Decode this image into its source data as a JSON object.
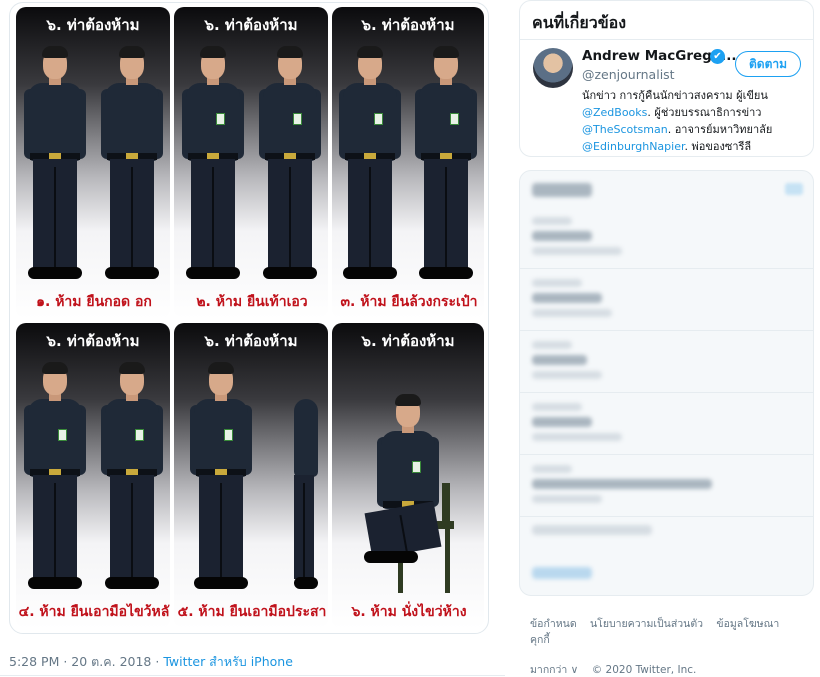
{
  "tweet": {
    "panels": [
      {
        "header": "๖. ท่าต้องห้าม",
        "caption": "๑. ห้าม ยืนกอด อก"
      },
      {
        "header": "๖. ท่าต้องห้าม",
        "caption": "๒. ห้าม ยืนเท้าเอว"
      },
      {
        "header": "๖. ท่าต้องห้าม",
        "caption": "๓. ห้าม ยืนล้วงกระเป๋า"
      },
      {
        "header": "๖. ท่าต้องห้าม",
        "caption": "๔. ห้าม ยืนเอามือไขว้หลั"
      },
      {
        "header": "๖. ท่าต้องห้าม",
        "caption": "๕. ห้าม ยืนเอามือประสา"
      },
      {
        "header": "๖. ท่าต้องห้าม",
        "caption": "๖. ห้าม นั่งไขว่ห้าง"
      }
    ],
    "time": "5:28 PM",
    "separator": " · ",
    "date": "20 ต.ค. 2018",
    "separator2": " · ",
    "source": "Twitter สำหรับ iPhone"
  },
  "related": {
    "title": "คนที่เกี่ยวข้อง",
    "user": {
      "name": "Andrew MacGrego...",
      "handle": "@zenjournalist",
      "follow_label": "ติดตาม",
      "verified_icon": "✔",
      "bio_1": "นักข่าว การกู้คืนนักข่าวสงคราม ผู้เขียน",
      "bio_link_1": "@ZedBooks",
      "bio_2": ". ผู้ช่วยบรรณาธิการข่าว",
      "bio_link_2": "@TheScotsman",
      "bio_3": ". อาจารย์มหาวิทยาลัย",
      "bio_link_3": "@EdinburghNapier",
      "bio_4": ". พ่อของซารีลี"
    }
  },
  "footer": {
    "terms": "ข้อกำหนด",
    "privacy": "นโยบายความเป็นส่วนตัว",
    "ads": "ข้อมูลโฆษณา",
    "cookies": "คุกกี้",
    "more": "มากกว่า ∨",
    "copyright": "© 2020 Twitter, Inc."
  }
}
